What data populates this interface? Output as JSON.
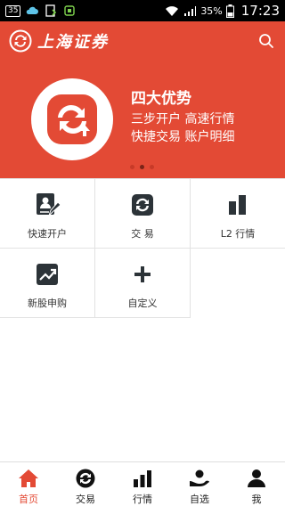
{
  "status_bar": {
    "notification_count": "35",
    "battery": "35%",
    "time": "17:23"
  },
  "header": {
    "brand": "上海证券",
    "search_icon": "search-icon"
  },
  "banner": {
    "title": "四大优势",
    "line1": "三步开户  高速行情",
    "line2": "快捷交易  账户明细",
    "slides": 3,
    "active_slide": 2
  },
  "grid": {
    "items": [
      {
        "label": "快速开户",
        "icon": "account-form-icon"
      },
      {
        "label": "交  易",
        "icon": "trade-exchange-icon"
      },
      {
        "label": "L2 行情",
        "icon": "bar-chart-icon"
      },
      {
        "label": "新股申购",
        "icon": "trend-chart-icon"
      },
      {
        "label": "自定义",
        "icon": "plus-icon"
      }
    ]
  },
  "bottom_nav": {
    "items": [
      {
        "label": "首页",
        "icon": "home-icon",
        "active": true
      },
      {
        "label": "交易",
        "icon": "trade-icon",
        "active": false
      },
      {
        "label": "行情",
        "icon": "market-icon",
        "active": false
      },
      {
        "label": "自选",
        "icon": "watchlist-icon",
        "active": false
      },
      {
        "label": "我",
        "icon": "user-icon",
        "active": false
      }
    ]
  },
  "colors": {
    "brand_red": "#e34a35",
    "text_dark": "#333333",
    "icon_dark": "#2c3338"
  }
}
